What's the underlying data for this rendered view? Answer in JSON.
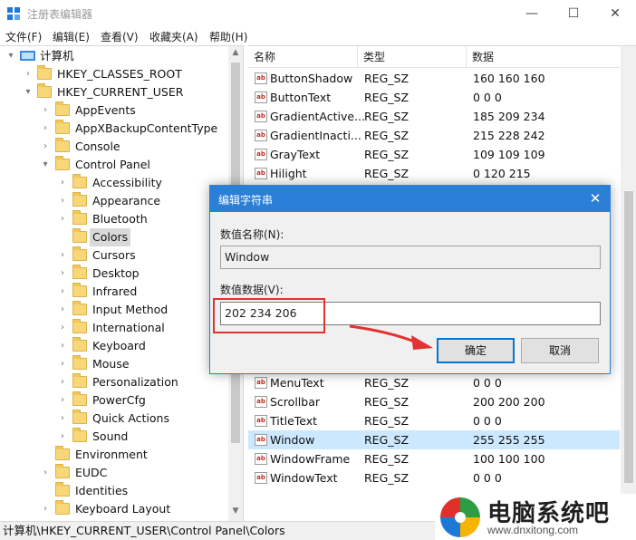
{
  "window": {
    "title": "注册表编辑器",
    "minimize_glyph": "—",
    "maximize_glyph": "☐",
    "close_glyph": "✕"
  },
  "menu": [
    "文件(F)",
    "编辑(E)",
    "查看(V)",
    "收藏夹(A)",
    "帮助(H)"
  ],
  "tree": {
    "root": "计算机",
    "hkcr": "HKEY_CLASSES_ROOT",
    "hkcu": "HKEY_CURRENT_USER",
    "hkcu_children": [
      "AppEvents",
      "AppXBackupContentType",
      "Console",
      "Control Panel"
    ],
    "control_panel_children": [
      "Accessibility",
      "Appearance",
      "Bluetooth",
      "Colors",
      "Cursors",
      "Desktop",
      "Infrared",
      "Input Method",
      "International",
      "Keyboard",
      "Mouse",
      "Personalization",
      "PowerCfg",
      "Quick Actions",
      "Sound"
    ],
    "hkcu_children_after": [
      "Environment",
      "EUDC",
      "Identities",
      "Keyboard Layout"
    ],
    "selected": "Colors"
  },
  "list": {
    "headers": [
      "名称",
      "类型",
      "数据"
    ],
    "rows_top": [
      {
        "name": "ButtonShadow",
        "type": "REG_SZ",
        "data": "160 160 160"
      },
      {
        "name": "ButtonText",
        "type": "REG_SZ",
        "data": "0 0 0"
      },
      {
        "name": "GradientActive...",
        "type": "REG_SZ",
        "data": "185 209 234"
      },
      {
        "name": "GradientInacti...",
        "type": "REG_SZ",
        "data": "215 228 242"
      },
      {
        "name": "GrayText",
        "type": "REG_SZ",
        "data": "109 109 109"
      },
      {
        "name": "Hilight",
        "type": "REG_SZ",
        "data": "0 120 215"
      }
    ],
    "rows_bottom": [
      {
        "name": "MenuText",
        "type": "REG_SZ",
        "data": "0 0 0"
      },
      {
        "name": "Scrollbar",
        "type": "REG_SZ",
        "data": "200 200 200"
      },
      {
        "name": "TitleText",
        "type": "REG_SZ",
        "data": "0 0 0"
      },
      {
        "name": "Window",
        "type": "REG_SZ",
        "data": "255 255 255"
      },
      {
        "name": "WindowFrame",
        "type": "REG_SZ",
        "data": "100 100 100"
      },
      {
        "name": "WindowText",
        "type": "REG_SZ",
        "data": "0 0 0"
      }
    ],
    "selected_row": "Window"
  },
  "status_path": "计算机\\HKEY_CURRENT_USER\\Control Panel\\Colors",
  "dialog": {
    "title": "编辑字符串",
    "name_label": "数值名称(N):",
    "name_value": "Window",
    "data_label": "数值数据(V):",
    "data_value": "202 234 206",
    "ok_label": "确定",
    "cancel_label": "取消"
  },
  "watermark": {
    "name": "电脑系统吧",
    "url": "www.dnxitong.com"
  },
  "colors": {
    "accent": "#2b7fd6",
    "selection": "#cce8ff",
    "highlight_box": "#e23232"
  }
}
